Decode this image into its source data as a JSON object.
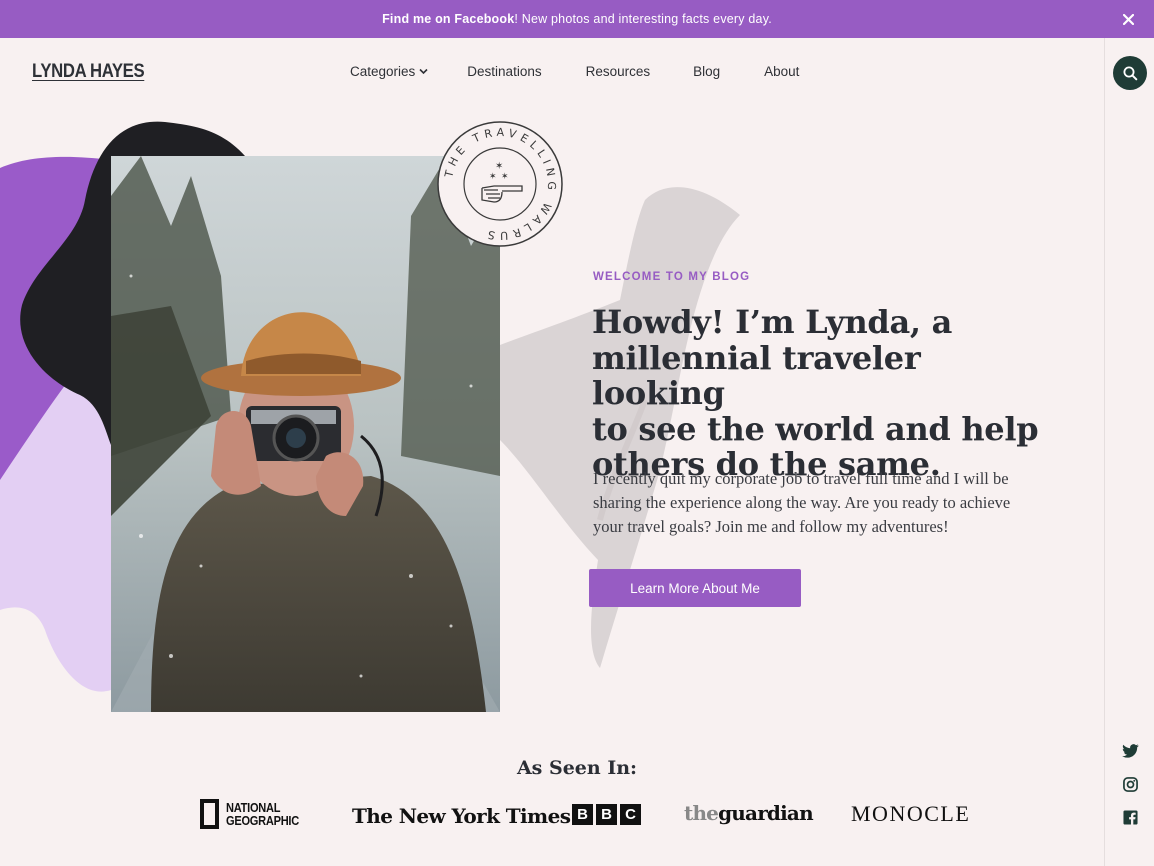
{
  "announcement": {
    "bold": "Find me on Facebook",
    "text": "! New photos and interesting facts every day."
  },
  "header": {
    "logo": "LYNDA HAYES",
    "nav": [
      "Categories",
      "Destinations",
      "Resources",
      "Blog",
      "About"
    ]
  },
  "stamp": {
    "text": "THE TRAVELLING WALRUS"
  },
  "hero": {
    "eyebrow": "WELCOME TO MY BLOG",
    "headline_lines": [
      "Howdy! I’m Lynda, a",
      "millennial traveler looking",
      "to see the world and help",
      "others do the same."
    ],
    "intro": "I recently quit my corporate job to travel full time and I will be sharing the experience along the way. Are you ready to achieve your travel goals?  Join me and follow my adventures!",
    "cta": "Learn More About Me"
  },
  "press": {
    "title": "As Seen In:",
    "natgeo_line1": "NATIONAL",
    "natgeo_line2": "GEOGRAPHIC",
    "nyt": "The New York Times",
    "bbc": [
      "B",
      "B",
      "C"
    ],
    "guardian_the": "the",
    "guardian_rest": "guardian",
    "monocle": "MONOCLE"
  },
  "colors": {
    "accent": "#975cc3",
    "dark_green": "#1f3c36",
    "background": "#f8f1f1"
  },
  "icons": [
    "close-icon",
    "chevron-down-icon",
    "search-icon",
    "twitter-icon",
    "instagram-icon",
    "facebook-icon"
  ]
}
